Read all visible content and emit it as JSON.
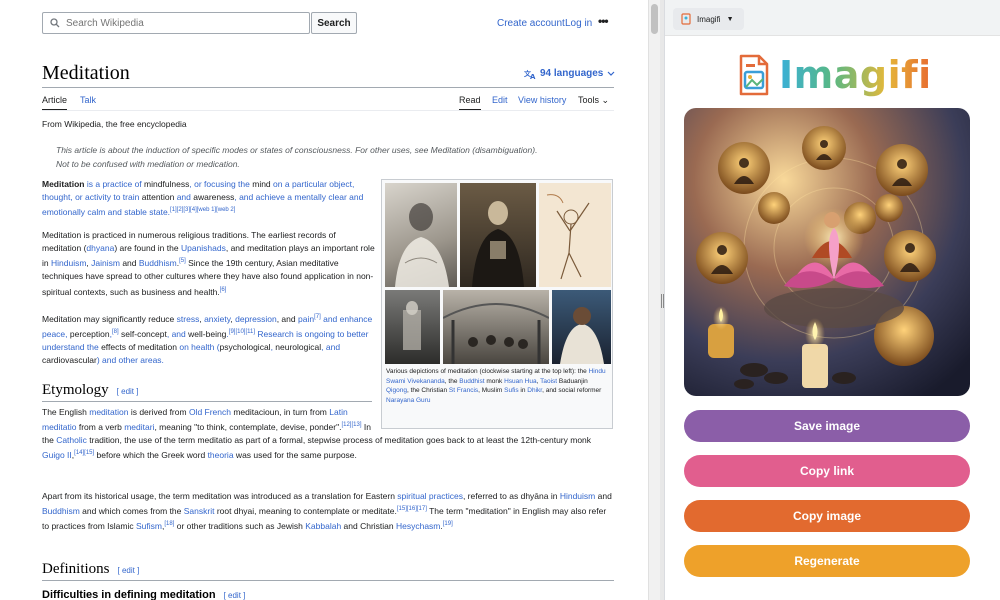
{
  "wiki": {
    "search_placeholder": "Search Wikipedia",
    "search_button": "Search",
    "create_account": "Create account",
    "login": "Log in",
    "title": "Meditation",
    "languages": "94 languages",
    "tabs": {
      "article": "Article",
      "talk": "Talk",
      "read": "Read",
      "edit": "Edit",
      "history": "View history",
      "tools": "Tools"
    },
    "from": "From Wikipedia, the free encyclopedia",
    "hatnote_1": "This article is about the induction of specific modes or states of consciousness. For other uses, see Meditation (disambiguation).",
    "hatnote_2": "Not to be confused with mediation or medication.",
    "p1": [
      "Meditation",
      " is a practice of ",
      "mindfulness",
      ", or focusing the ",
      "mind",
      " on a particular object, thought, or activity to train ",
      "attention",
      " and ",
      "awareness",
      ", and achieve a mentally clear and emotionally calm and stable state.",
      "[1][2][3][4][web 1][web 2]"
    ],
    "p2": [
      "Meditation is practiced in numerous religious traditions. The earliest records of meditation (",
      "dhyana",
      ") are found in the ",
      "Upanishads",
      ", and meditation plays an important role in ",
      "Hinduism",
      ", ",
      "Jainism",
      " and ",
      "Buddhism",
      ".",
      "[5]",
      " Since the 19th century, Asian meditative techniques have spread to other cultures where they have also found application in non-spiritual contexts, such as business and health.",
      "[6]"
    ],
    "p3": [
      "Meditation may significantly reduce ",
      "stress",
      ", ",
      "anxiety",
      ", ",
      "depression",
      ", and ",
      "pain",
      "[7]",
      " and enhance peace, ",
      "perception",
      ",",
      "[8]",
      " ",
      "self-concept",
      ", and ",
      "well-being",
      ".",
      "[9][10][11]",
      " Research is ongoing to better understand the ",
      "effects of meditation",
      " on health (",
      "psychological",
      ", ",
      "neurological",
      ", and ",
      "cardiovascular",
      ") and other areas."
    ],
    "etymology": "Etymology",
    "edit_label": "edit",
    "p4": [
      "The English ",
      "meditation",
      " is derived from ",
      "Old French",
      " meditacioun, in turn from ",
      "Latin",
      " ",
      "meditatio",
      " from a verb ",
      "meditari",
      ", meaning \"to think, contemplate, devise, ponder\".",
      "[12][13]",
      " In the ",
      "Catholic",
      " tradition, the use of the term meditatio as part of a formal, stepwise process of meditation goes back to at least the 12th-century monk ",
      "Guigo II",
      ",",
      "[14][15]",
      " before which the Greek word ",
      "theoria",
      " was used for the same purpose."
    ],
    "p5": [
      "Apart from its historical usage, the term meditation was introduced as a translation for Eastern ",
      "spiritual practices",
      ", referred to as dhyāna in ",
      "Hinduism",
      " and ",
      "Buddhism",
      " and which comes from the ",
      "Sanskrit",
      " root dhyai, meaning to contemplate or meditate.",
      "[15][16][17]",
      " The term \"meditation\" in English may also refer to practices from Islamic ",
      "Sufism",
      ",",
      "[18]",
      " or other traditions such as Jewish ",
      "Kabbalah",
      " and Christian ",
      "Hesychasm",
      ".",
      "[19]"
    ],
    "definitions": "Definitions",
    "difficulties": "Difficulties in defining meditation",
    "caption": [
      "Various depictions of meditation (clockwise starting at the top left): the ",
      "Hindu Swami Vivekananda",
      ", the ",
      "Buddhist",
      " monk ",
      "Hsuan Hua",
      ", ",
      "Taoist",
      " Baduanjin ",
      "Qigong",
      ", the Christian ",
      "St Francis",
      ", Muslim ",
      "Sufis",
      " in ",
      "Dhikr",
      ", and social reformer ",
      "Narayana Guru"
    ]
  },
  "panel": {
    "chip": "Imagifi",
    "brand": "Imagifi",
    "buttons": [
      {
        "label": "Save image",
        "color": "#8b5ea8"
      },
      {
        "label": "Copy link",
        "color": "#e15e8e"
      },
      {
        "label": "Copy image",
        "color": "#e26a2f"
      },
      {
        "label": "Regenerate",
        "color": "#eea12a"
      }
    ]
  },
  "colors": {
    "link": "#3366cc",
    "panel_bg": "#ffffff"
  }
}
